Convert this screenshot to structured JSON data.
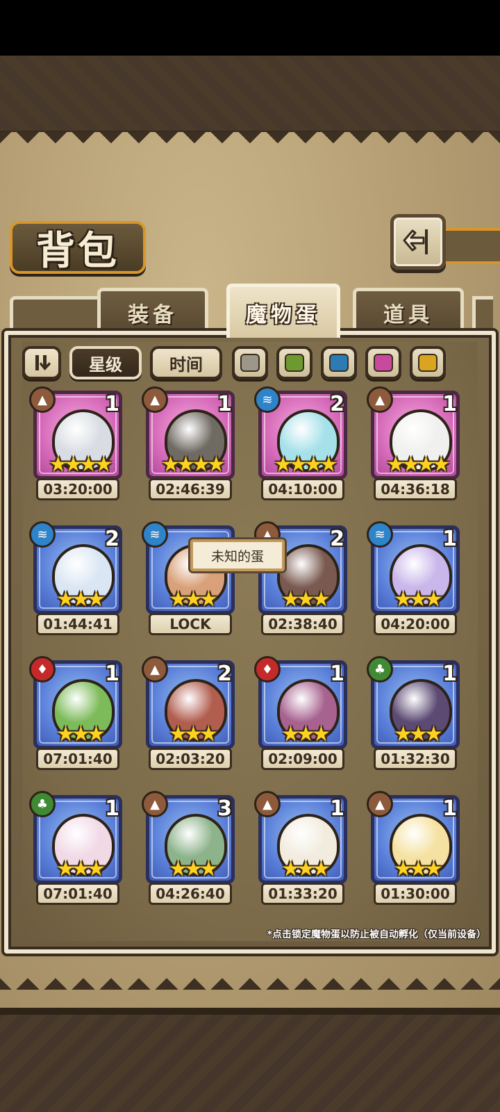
{
  "header": {
    "title": "背包"
  },
  "tabs": [
    {
      "label": "装备",
      "active": false
    },
    {
      "label": "魔物蛋",
      "active": true
    },
    {
      "label": "道具",
      "active": false
    }
  ],
  "sort": {
    "star_label": "星级",
    "time_label": "时间",
    "selected": "星级"
  },
  "color_filters": [
    "#9c9788",
    "#6c9a2f",
    "#2d7bb4",
    "#c94a9d",
    "#d9a41f"
  ],
  "tooltip": "未知的蛋",
  "eggs": [
    {
      "element": "earth",
      "count": "1",
      "stars": "★★★★",
      "timer": "03:20:00",
      "rarity": "pink",
      "color": "#d9dde3"
    },
    {
      "element": "earth",
      "count": "1",
      "stars": "★★★★",
      "timer": "02:46:39",
      "rarity": "pink",
      "color": "#6f6a62"
    },
    {
      "element": "water",
      "count": "2",
      "stars": "★★★★",
      "timer": "04:10:00",
      "rarity": "pink",
      "color": "#a6e1ea"
    },
    {
      "element": "earth",
      "count": "1",
      "stars": "★★★★",
      "timer": "04:36:18",
      "rarity": "pink",
      "color": "#f0f0ee"
    },
    {
      "element": "water",
      "count": "2",
      "stars": "★★★",
      "timer": "01:44:41",
      "rarity": "blue",
      "color": "#dbe6f4"
    },
    {
      "element": "water",
      "count": "",
      "stars": "★★★",
      "timer": "LOCK",
      "rarity": "blue",
      "color": "#d9a179"
    },
    {
      "element": "earth",
      "count": "2",
      "stars": "★★★",
      "timer": "02:38:40",
      "rarity": "blue",
      "color": "#7a5a50"
    },
    {
      "element": "water",
      "count": "1",
      "stars": "★★★",
      "timer": "04:20:00",
      "rarity": "blue",
      "color": "#c9b6ea"
    },
    {
      "element": "fire",
      "count": "1",
      "stars": "★★★",
      "timer": "07:01:40",
      "rarity": "blue",
      "color": "#7dbb5a"
    },
    {
      "element": "earth",
      "count": "2",
      "stars": "★★★",
      "timer": "02:03:20",
      "rarity": "blue",
      "color": "#b15e4f"
    },
    {
      "element": "fire",
      "count": "1",
      "stars": "★★★",
      "timer": "02:09:00",
      "rarity": "blue",
      "color": "#a7628f"
    },
    {
      "element": "grass",
      "count": "1",
      "stars": "★★★",
      "timer": "01:32:30",
      "rarity": "blue",
      "color": "#5c4a73"
    },
    {
      "element": "grass",
      "count": "1",
      "stars": "★★★",
      "timer": "07:01:40",
      "rarity": "blue",
      "color": "#f1d9e6"
    },
    {
      "element": "earth",
      "count": "3",
      "stars": "★★★",
      "timer": "04:26:40",
      "rarity": "blue",
      "color": "#8cb38a"
    },
    {
      "element": "earth",
      "count": "1",
      "stars": "★★★",
      "timer": "01:33:20",
      "rarity": "blue",
      "color": "#f2ecdf"
    },
    {
      "element": "earth",
      "count": "1",
      "stars": "★★★",
      "timer": "01:30:00",
      "rarity": "blue",
      "color": "#f5e2a2"
    }
  ],
  "footnote": "*点击锁定魔物蛋以防止被自动孵化（仅当前设备）"
}
